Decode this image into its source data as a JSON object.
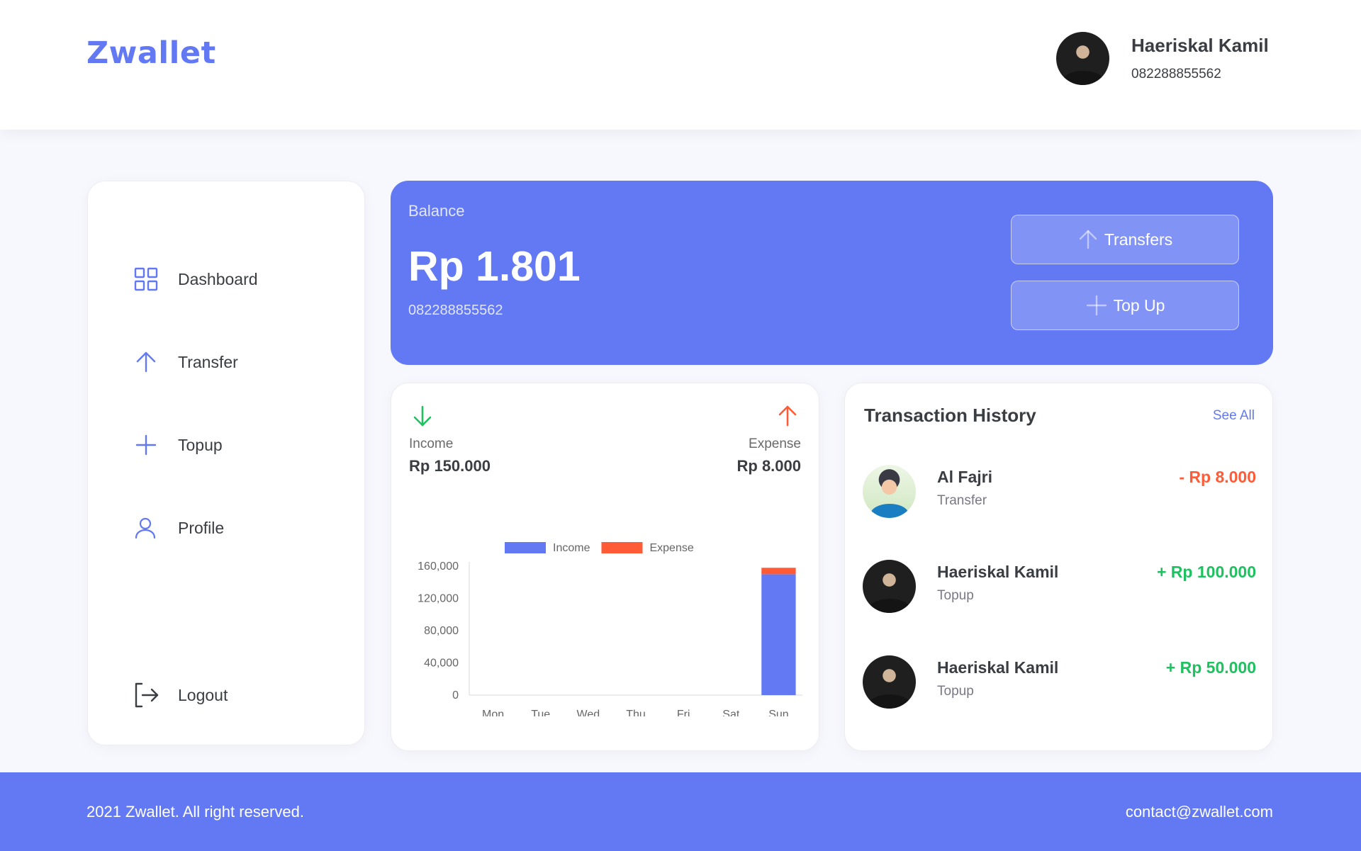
{
  "header": {
    "brand": "Zwallet",
    "user": {
      "name": "Haeriskal Kamil",
      "phone": "082288855562"
    }
  },
  "sidebar": {
    "items": [
      {
        "label": "Dashboard",
        "icon": "grid-icon"
      },
      {
        "label": "Transfer",
        "icon": "arrow-up-icon"
      },
      {
        "label": "Topup",
        "icon": "plus-icon"
      },
      {
        "label": "Profile",
        "icon": "user-icon"
      }
    ],
    "logout": {
      "label": "Logout",
      "icon": "logout-icon"
    }
  },
  "balance": {
    "label": "Balance",
    "amount": "Rp 1.801",
    "phone": "082288855562",
    "transfers_label": "Transfers",
    "topup_label": "Top Up"
  },
  "summary": {
    "income_label": "Income",
    "income_value": "Rp 150.000",
    "expense_label": "Expense",
    "expense_value": "Rp 8.000"
  },
  "chart_data": {
    "type": "bar",
    "stacked": true,
    "categories": [
      "Mon",
      "Tue",
      "Wed",
      "Thu",
      "Fri",
      "Sat",
      "Sun"
    ],
    "series": [
      {
        "name": "Income",
        "values": [
          0,
          0,
          0,
          0,
          0,
          0,
          150000
        ],
        "color": "#6379f4"
      },
      {
        "name": "Expense",
        "values": [
          0,
          0,
          0,
          0,
          0,
          0,
          8000
        ],
        "color": "#ff5b37"
      }
    ],
    "yticks": [
      0,
      40000,
      80000,
      120000,
      160000
    ],
    "ytick_labels": [
      "0",
      "40,000",
      "80,000",
      "120,000",
      "160,000"
    ],
    "ylim": [
      0,
      160000
    ],
    "legend": "top"
  },
  "history": {
    "title": "Transaction History",
    "see_all": "See All",
    "items": [
      {
        "name": "Al Fajri",
        "type": "Transfer",
        "amount": "- Rp 8.000",
        "color": "#ff5b37"
      },
      {
        "name": "Haeriskal Kamil",
        "type": "Topup",
        "amount": "+ Rp 100.000",
        "color": "#1ec15f"
      },
      {
        "name": "Haeriskal Kamil",
        "type": "Topup",
        "amount": "+ Rp 50.000",
        "color": "#1ec15f"
      }
    ]
  },
  "footer": {
    "copyright": "2021 Zwallet. All right reserved.",
    "contact": "contact@zwallet.com"
  },
  "colors": {
    "primary": "#6379f4",
    "income": "#1ec15f",
    "expense": "#ff5b37"
  }
}
